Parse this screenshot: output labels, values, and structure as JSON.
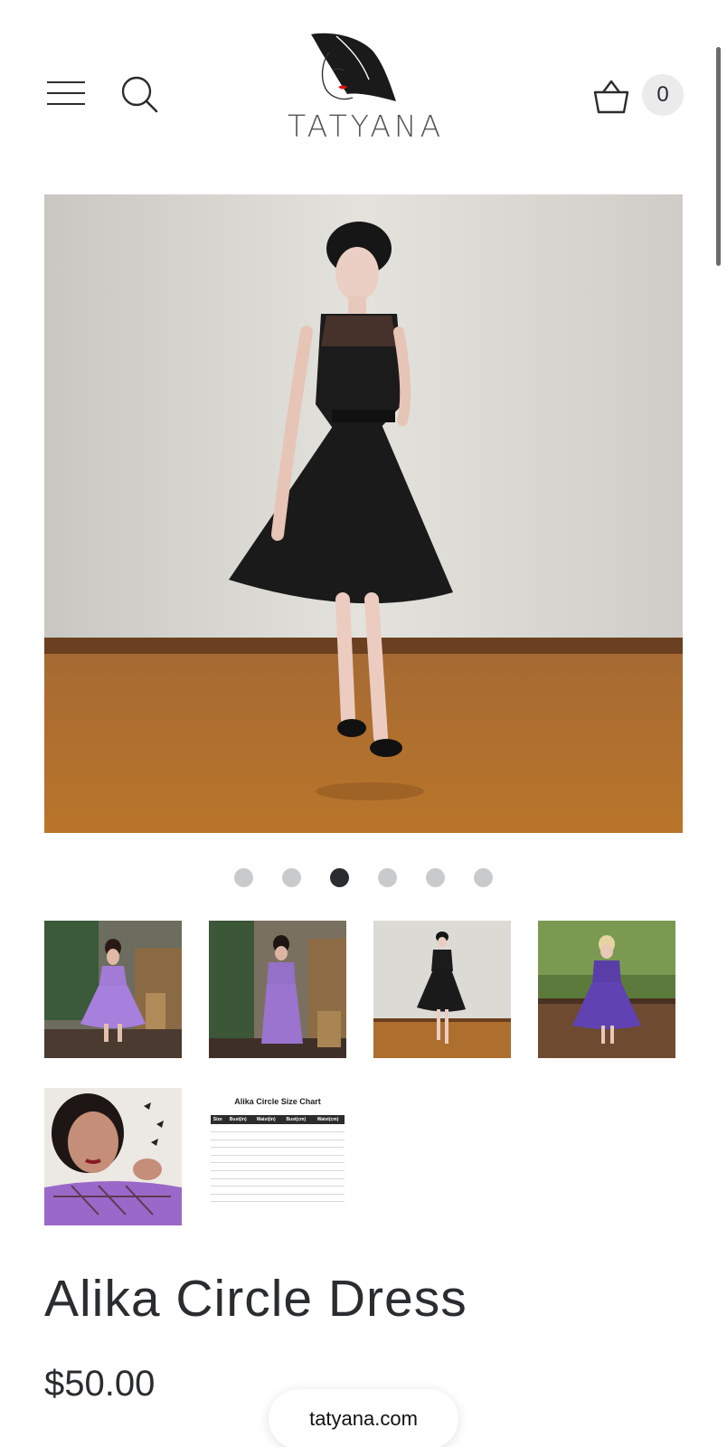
{
  "header": {
    "logo_text": "TATYANA",
    "cart_count": "0",
    "icons": [
      "menu-icon",
      "search-icon",
      "logo-icon",
      "cart-basket-icon"
    ]
  },
  "product": {
    "title": "Alika Circle Dress",
    "price": "$50.00"
  },
  "carousel": {
    "total_slides": 6,
    "active_index": 2
  },
  "size_chart": {
    "title": "Alika Circle Size Chart",
    "headers": [
      "Size",
      "Bust(in)",
      "Waist(in)",
      "Bust(cm)",
      "Waist(cm)"
    ]
  },
  "browser": {
    "url": "tatyana.com"
  },
  "colors": {
    "text": "#2a2d30",
    "dot_active": "#2a2d30",
    "dot_inactive": "#c9cacb",
    "cart_badge": "#ebebeb"
  }
}
